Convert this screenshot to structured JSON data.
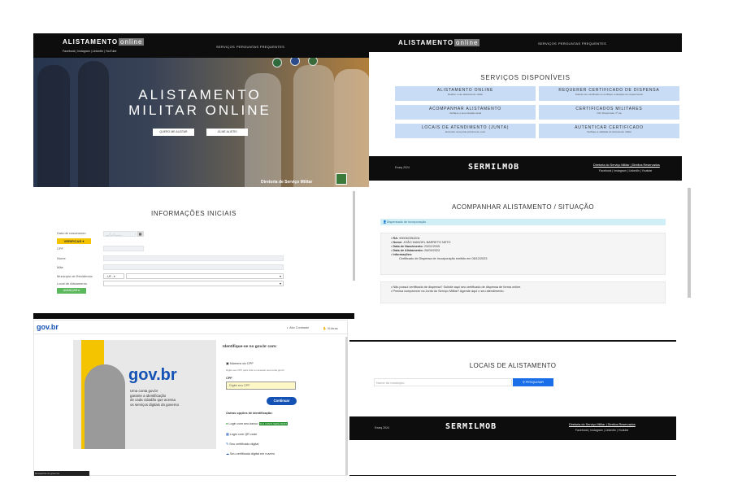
{
  "p1": {
    "brand": "ALISTAMENTO",
    "brand_box": "online",
    "mini_links": [
      "Facebook",
      "Instagram",
      "LinkedIn",
      "YouTube"
    ],
    "nav": [
      "SERVIÇOS",
      "PERGUNTAS FREQUENTES"
    ],
    "title_line1": "ALISTAMENTO",
    "title_line2": "MILITAR ONLINE",
    "btn_want": "QUERO ME ALISTAR",
    "btn_already": "JÁ ME ALISTEI",
    "footer_sig": "Diretoria de Serviço Militar"
  },
  "p2": {
    "brand": "ALISTAMENTO",
    "brand_box": "online",
    "nav": [
      "SERVIÇOS",
      "PERGUNTAS FREQUENTES"
    ],
    "heading": "SERVIÇOS DISPONÍVEIS",
    "services": [
      {
        "title": "ALISTAMENTO ONLINE",
        "sub": "Realize o seu alistamento militar"
      },
      {
        "title": "REQUERER CERTIFICADO DE DISPENSA",
        "sub": "Solicite seu certificado ou verifique a situação do requerimento"
      },
      {
        "title": "ACOMPANHAR ALISTAMENTO",
        "sub": "Verifique a sua situação atual"
      },
      {
        "title": "CERTIFICADOS MILITARES",
        "sub": "CDI, Reservista, 1ª via"
      },
      {
        "title": "LOCAIS DE ATENDIMENTO (JUNTA)",
        "sub": "Encontre uma junta próxima de você"
      },
      {
        "title": "AUTENTICAR CERTIFICADO",
        "sub": "Verifique a validade do documento militar"
      }
    ],
    "footer_left": "Exarq 2024",
    "footer_logo": "SERMILMOB",
    "footer_right": "Diretoria do Serviço Militar | Direitos Reservados",
    "footer_links": "Facebook | Instagram | LinkedIn | Youtube"
  },
  "p3": {
    "heading": "INFORMAÇÕES INICIAIS",
    "labels": [
      "Data de nascimento",
      "CPF",
      "Nome",
      "Mãe",
      "Município de Residência",
      "Local de Alistamento"
    ],
    "date_placeholder": "__/__/____",
    "btn_verify": "VERIFICAR",
    "uf_select": "- UF -",
    "btn_next": "AVANÇAR"
  },
  "p4": {
    "heading": "ACOMPANHAR ALISTAMENTO / SITUAÇÃO",
    "status": "Dispensado de incorporação",
    "items": [
      {
        "k": "RA:",
        "v": "900062354204"
      },
      {
        "k": "Nome:",
        "v": "JOÃO MANOEL BARRETO NETO"
      },
      {
        "k": "Data de Nascimento:",
        "v": "23/02/2005"
      },
      {
        "k": "Data de Alistamento:",
        "v": "26/09/2023"
      },
      {
        "k": "Informações:",
        "v": ""
      }
    ],
    "sub_item": "Certificado de Dispensa de Incorporação emitido em 06/12/2023",
    "note1": "Não possui certificado de dispensa? Solicite aqui seu certificado de dispensa de forma online.",
    "note2": "Precisa comparecer na Junta do Serviço Militar? Agende aqui o seu atendimento."
  },
  "p5": {
    "logo": "gov.br",
    "top_links": [
      "Alto Contraste",
      "VLibras"
    ],
    "hero_logo": "gov.br",
    "hero_text1": "Uma conta gov.br",
    "hero_text2": "garante a identificação",
    "hero_text3": "de cada cidadão que acessa",
    "hero_text4": "os serviços digitais do governo",
    "right_title": "Identifique-se no gov.br com:",
    "cpf_option": "Número do CPF",
    "cpf_hint": "Digite seu CPF para criar ou acessar sua conta gov.br",
    "cpf_label": "CPF",
    "cpf_placeholder": "Digite seu CPF",
    "btn_continue": "Continuar",
    "other_title": "Outras opções de identificação:",
    "options": [
      {
        "label": "Login com seu banco",
        "badge": "SUA CONTA SERÁ PRATA"
      },
      {
        "label": "Login com QR code",
        "badge": ""
      },
      {
        "label": "Seu certificado digital",
        "badge": ""
      },
      {
        "label": "Seu certificado digital em nuvem",
        "badge": ""
      }
    ],
    "bottom_tag": "Recaptcha do governo"
  },
  "p6": {
    "heading": "LOCAIS DE ALISTAMENTO",
    "placeholder": "Nome do município",
    "btn_search": "PESQUISAR",
    "footer_left": "Exarq 2024",
    "footer_logo": "SERMILMOB",
    "footer_right": "Diretoria do Serviço Militar | Direitos Reservados",
    "footer_links": "Facebook | Instagram | LinkedIn | Youtube"
  },
  "colors": {
    "dark": "#0d0d0d",
    "service_blue": "#c9dcf5",
    "yellow": "#f5c400",
    "green": "#5cb85c",
    "gov_blue": "#1351b4",
    "search_blue": "#1a6fe8"
  }
}
